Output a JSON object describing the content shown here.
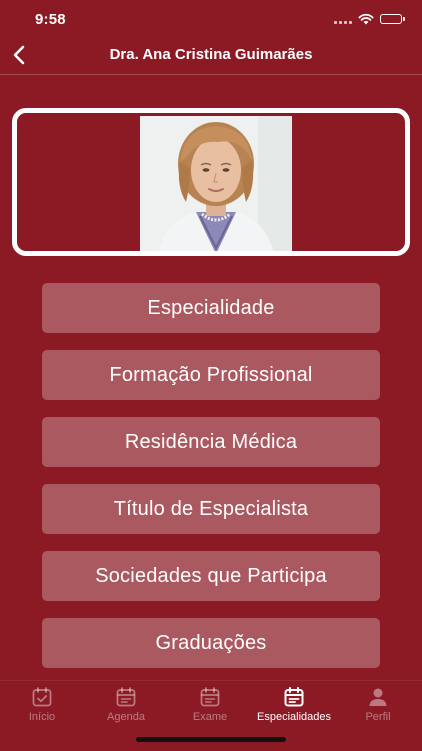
{
  "status_bar": {
    "time": "9:58"
  },
  "header": {
    "title": "Dra. Ana Cristina Guimarães"
  },
  "menu": {
    "items": [
      {
        "label": "Especialidade"
      },
      {
        "label": "Formação Profissional"
      },
      {
        "label": "Residência Médica"
      },
      {
        "label": "Título de Especialista"
      },
      {
        "label": "Sociedades que Participa"
      },
      {
        "label": "Graduações"
      }
    ]
  },
  "tab_bar": {
    "tabs": [
      {
        "label": "Início",
        "icon": "calendar-check-icon"
      },
      {
        "label": "Agenda",
        "icon": "calendar-icon"
      },
      {
        "label": "Exame",
        "icon": "calendar-icon"
      },
      {
        "label": "Especialidades",
        "icon": "calendar-list-icon",
        "active": true
      },
      {
        "label": "Perfil",
        "icon": "person-icon"
      }
    ]
  },
  "colors": {
    "background": "#8b1a24",
    "button": "rgba(255,255,255,0.28)",
    "text": "#ffffff"
  }
}
